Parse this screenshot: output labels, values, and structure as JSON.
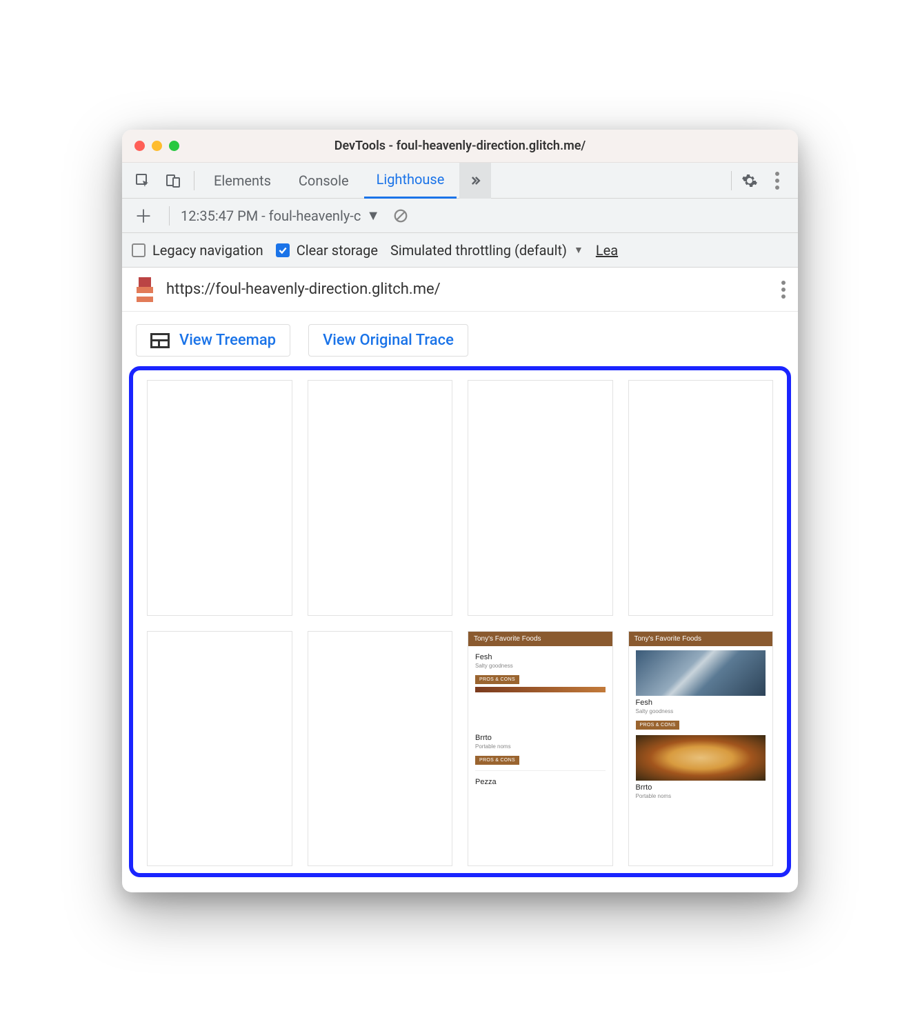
{
  "window": {
    "title": "DevTools - foul-heavenly-direction.glitch.me/"
  },
  "tabs": {
    "elements": "Elements",
    "console": "Console",
    "lighthouse": "Lighthouse"
  },
  "runbar": {
    "selected": "12:35:47 PM - foul-heavenly-c"
  },
  "options": {
    "legacy": "Legacy navigation",
    "clear": "Clear storage",
    "throttling": "Simulated throttling (default)",
    "learn": "Lea"
  },
  "url": "https://foul-heavenly-direction.glitch.me/",
  "actions": {
    "treemap": "View Treemap",
    "trace": "View Original Trace"
  },
  "mini": {
    "header": "Tony's Favorite Foods",
    "items": [
      {
        "title": "Fesh",
        "sub": "Salty goodness",
        "btn": "PROS & CONS"
      },
      {
        "title": "Brrto",
        "sub": "Portable noms",
        "btn": "PROS & CONS"
      },
      {
        "title": "Pezza",
        "sub": "",
        "btn": ""
      }
    ]
  }
}
